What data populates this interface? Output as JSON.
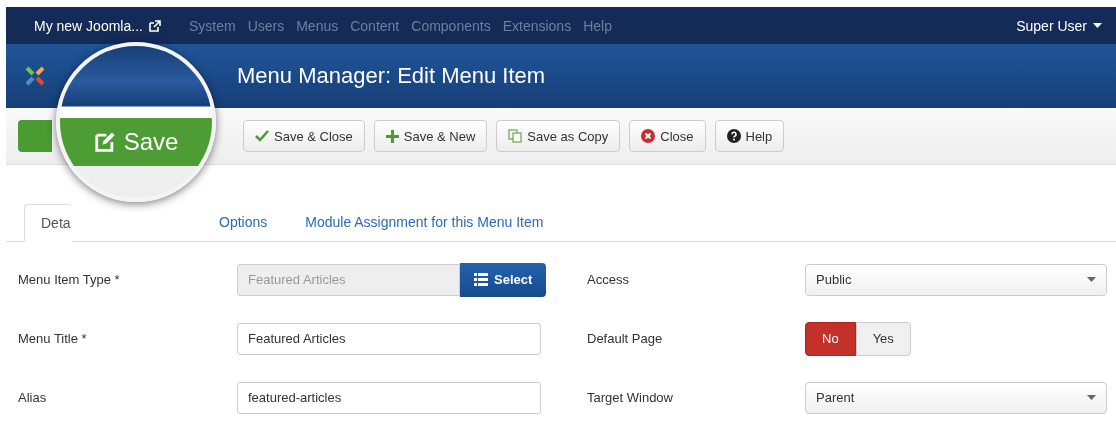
{
  "top_bar": {
    "site": "My new Joomla...",
    "menu": [
      "System",
      "Users",
      "Menus",
      "Content",
      "Components",
      "Extensions",
      "Help"
    ],
    "user": "Super User"
  },
  "header": {
    "title": "Menu Manager: Edit Menu Item"
  },
  "toolbar": {
    "buttons": [
      {
        "kind": "save",
        "label": "Save"
      },
      {
        "kind": "save-close",
        "label": "Save & Close"
      },
      {
        "kind": "save-new",
        "label": "Save & New"
      },
      {
        "kind": "copy",
        "label": "Save as Copy"
      },
      {
        "kind": "close",
        "label": "Close"
      },
      {
        "kind": "help",
        "label": "Help"
      }
    ]
  },
  "tabs": [
    {
      "label": "Deta",
      "selected": true
    },
    {
      "label": "Options",
      "selected": false
    },
    {
      "label": "Module Assignment for this Menu Item",
      "selected": false
    }
  ],
  "form": {
    "left": [
      {
        "kind": "picker",
        "label": "Menu Item Type *",
        "value": "Featured Articles",
        "button": "Select"
      },
      {
        "kind": "text",
        "label": "Menu Title *",
        "value": "Featured Articles"
      },
      {
        "kind": "text",
        "label": "Alias",
        "value": "featured-articles"
      }
    ],
    "right": [
      {
        "kind": "select",
        "label": "Access",
        "value": "Public"
      },
      {
        "kind": "toggle",
        "label": "Default Page",
        "options": [
          {
            "label": "No",
            "selected": true
          },
          {
            "label": "Yes",
            "selected": false
          }
        ]
      },
      {
        "kind": "select",
        "label": "Target Window",
        "value": "Parent"
      }
    ]
  }
}
